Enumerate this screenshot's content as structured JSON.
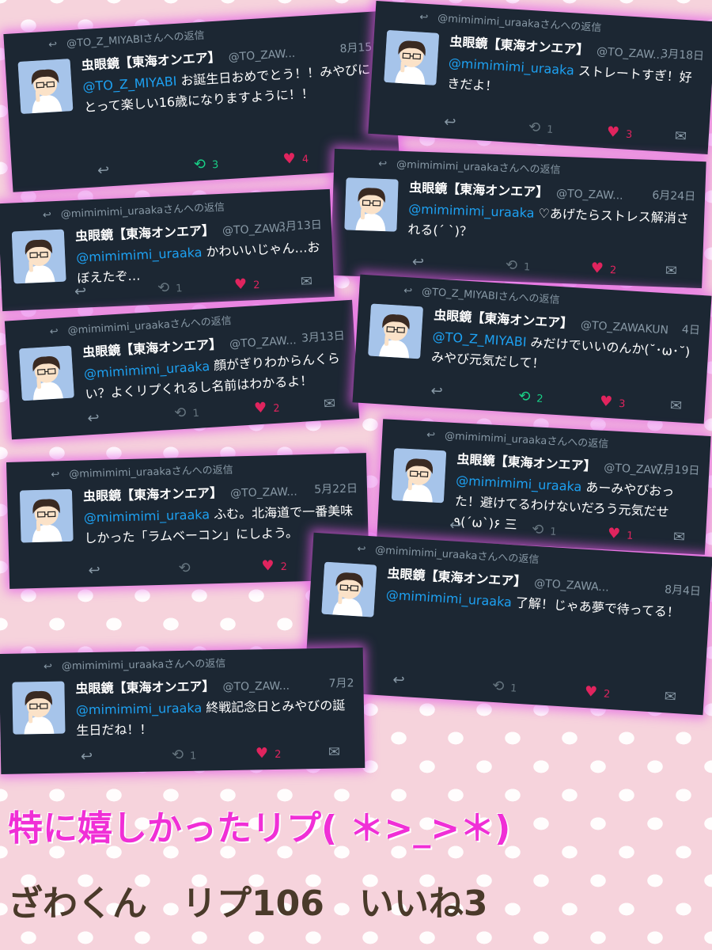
{
  "tweets": [
    {
      "reply_to": "@TO_Z_MIYABIさんへの返信",
      "name": "虫眼鏡【東海オンエア】",
      "handle": "@TO_ZAW...",
      "date": "8月15日",
      "mention": "@TO_Z_MIYABI",
      "text": " お誕生日おめでとう！！みやびにとって楽しい16歳になりますように！！",
      "retweets": "3",
      "likes": "4",
      "retweeted": true
    },
    {
      "reply_to": "@mimimimi_uraakaさんへの返信",
      "name": "虫眼鏡【東海オンエア】",
      "handle": "@TO_ZAW...",
      "date": "3月18日",
      "mention": "@mimimimi_uraaka",
      "text": " ストレートすぎ！好きだよ！",
      "retweets": "1",
      "likes": "3",
      "retweeted": false
    },
    {
      "reply_to": "@mimimimi_uraakaさんへの返信",
      "name": "虫眼鏡【東海オンエア】",
      "handle": "@TO_ZAW...",
      "date": "6月24日",
      "mention": "@mimimimi_uraaka",
      "text": " ♡あげたらストレス解消される(´ `)？",
      "retweets": "1",
      "likes": "2",
      "retweeted": false
    },
    {
      "reply_to": "@mimimimi_uraakaさんへの返信",
      "name": "虫眼鏡【東海オンエア】",
      "handle": "@TO_ZAW...",
      "date": "3月13日",
      "mention": "@mimimimi_uraaka",
      "text": " かわいいじゃん…おぼえたぞ…",
      "retweets": "1",
      "likes": "2",
      "retweeted": false
    },
    {
      "reply_to": "@mimimimi_uraakaさんへの返信",
      "name": "虫眼鏡【東海オンエア】",
      "handle": "@TO_ZAW...",
      "date": "3月13日",
      "mention": "@mimimimi_uraaka",
      "text": " 顔がぎりわからんくらい？よくリプくれるし名前はわかるよ！",
      "retweets": "1",
      "likes": "2",
      "retweeted": false
    },
    {
      "reply_to": "@TO_Z_MIYABIさんへの返信",
      "name": "虫眼鏡【東海オンエア】",
      "handle": "@TO_ZAWAKUN",
      "date": "4日",
      "mention": "@TO_Z_MIYABI",
      "text": " みだけでいいのんか(˘･ω･˘)みやび元気だして！",
      "retweets": "2",
      "likes": "3",
      "retweeted": true
    },
    {
      "reply_to": "@mimimimi_uraakaさんへの返信",
      "name": "虫眼鏡【東海オンエア】",
      "handle": "@TO_ZAW...",
      "date": "5月22日",
      "mention": "@mimimimi_uraaka",
      "text": " ふむ。北海道で一番美味しかった「ラムベーコン」にしよう。",
      "retweets": "",
      "likes": "2",
      "retweeted": false
    },
    {
      "reply_to": "@mimimimi_uraakaさんへの返信",
      "name": "虫眼鏡【東海オンエア】",
      "handle": "@TO_ZAW...",
      "date": "7月19日",
      "mention": "@mimimimi_uraaka",
      "text": " あーみやびおった！避けてるわけないだろう元気だせ ٩(ˊωˋ)۶ 三",
      "retweets": "1",
      "likes": "1",
      "retweeted": false
    },
    {
      "reply_to": "@mimimimi_uraakaさんへの返信",
      "name": "虫眼鏡【東海オンエア】",
      "handle": "@TO_ZAWA...",
      "date": "8月4日",
      "mention": "@mimimimi_uraaka",
      "text": " 了解！じゃあ夢で待ってる！",
      "retweets": "1",
      "likes": "2",
      "retweeted": false
    },
    {
      "reply_to": "@mimimimi_uraakaさんへの返信",
      "name": "虫眼鏡【東海オンエア】",
      "handle": "@TO_ZAW...",
      "date": "7月2",
      "mention": "@mimimimi_uraaka",
      "text": " 終戦記念日とみやびの誕生日だね！！",
      "retweets": "1",
      "likes": "2",
      "retweeted": false
    }
  ],
  "caption": "特に嬉しかったリプ( ＊>_>＊)",
  "stats": "ざわくん　リプ106　いいね3",
  "colors": {
    "card_bg": "#1c2733",
    "mention": "#1da1f2",
    "like": "#e0245e",
    "retweet_active": "#19cf86",
    "caption": "#f02fd6"
  }
}
